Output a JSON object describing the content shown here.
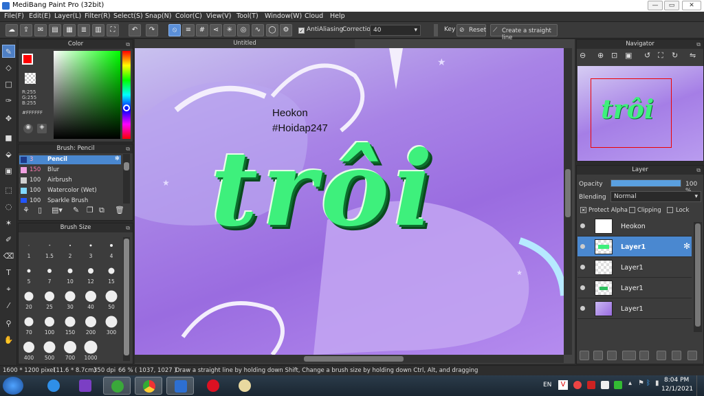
{
  "window": {
    "title": "MediBang Paint Pro (32bit)",
    "minimize": "—",
    "maximize": "▭",
    "close": "✕"
  },
  "menu": [
    "File(F)",
    "Edit(E)",
    "Layer(L)",
    "Filter(R)",
    "Select(S)",
    "Snap(N)",
    "Color(C)",
    "View(V)",
    "Tool(T)",
    "Window(W)",
    "Cloud",
    "Help"
  ],
  "toolbar": {
    "antialiasing_label": "AntiAliasing",
    "correction_label": "Correction",
    "correction_value": "40",
    "key_label": "Key",
    "reset_label": "Reset",
    "straight_line_label": "Create a straight line"
  },
  "color_panel": {
    "title": "Color",
    "r": "R:255",
    "g": "G:255",
    "b": "B:255",
    "hex": "#FFFFFF",
    "fg_color": "#ff0000",
    "bg_color": "#ffffff"
  },
  "brush_panel": {
    "title": "Brush: Pencil",
    "items": [
      {
        "size": "3",
        "name": "Pencil",
        "color": "#1e3a8a"
      },
      {
        "size": "150",
        "name": "Blur",
        "color": "#f0a0e0"
      },
      {
        "size": "100",
        "name": "Airbrush",
        "color": "#d0d0d0"
      },
      {
        "size": "100",
        "name": "Watercolor (Wet)",
        "color": "#80d8ff"
      },
      {
        "size": "100",
        "name": "Sparkle Brush",
        "color": "#2255ff"
      }
    ]
  },
  "brush_size_panel": {
    "title": "Brush Size",
    "sizes": [
      "1",
      "1.5",
      "2",
      "3",
      "4",
      "5",
      "7",
      "10",
      "12",
      "15",
      "20",
      "25",
      "30",
      "40",
      "50",
      "70",
      "100",
      "150",
      "200",
      "300",
      "400",
      "500",
      "700",
      "1000"
    ]
  },
  "canvas": {
    "tab_title": "Untitled",
    "text_line1": "Heokon",
    "text_line2": "#Hoidap247",
    "lettering": "trôi"
  },
  "navigator": {
    "title": "Navigator"
  },
  "layer_panel": {
    "title": "Layer",
    "opacity_label": "Opacity",
    "opacity_value": "100 %",
    "opacity": 1.0,
    "blending_label": "Blending",
    "blending_value": "Normal",
    "protect_alpha": "Protect Alpha",
    "clipping": "Clipping",
    "lock": "Lock",
    "layers": [
      "Heokon",
      "Layer1",
      "Layer1",
      "Layer1",
      "Layer1"
    ]
  },
  "status": {
    "size": "1600 * 1200 pixel",
    "dims": "(11.6 * 8.7cm)",
    "dpi": "350 dpi",
    "zoom": "66 %",
    "coords": "( 1037, 1027 )",
    "hint": "Draw a straight line by holding down Shift, Change a brush size by holding down Ctrl, Alt, and dragging"
  },
  "taskbar": {
    "lang": "EN",
    "time": "8:04 PM",
    "date": "12/1/2021"
  }
}
